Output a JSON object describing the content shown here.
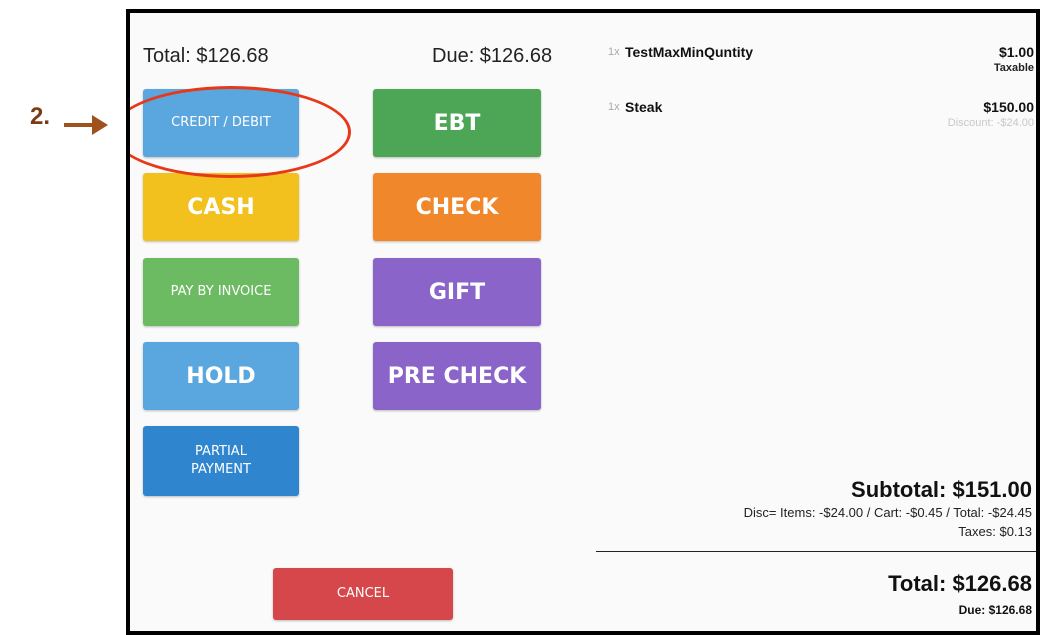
{
  "annotation": {
    "step": "2."
  },
  "header": {
    "total": "Total: $126.68",
    "due": "Due: $126.68"
  },
  "buttons": {
    "credit_debit": "CREDIT / DEBIT",
    "ebt": "EBT",
    "cash": "CASH",
    "check": "CHECK",
    "pay_by_invoice": "PAY BY INVOICE",
    "gift": "GIFT",
    "hold": "HOLD",
    "pre_check": "PRE CHECK",
    "partial_payment_line1": "PARTIAL",
    "partial_payment_line2": "PAYMENT",
    "cancel": "CANCEL"
  },
  "items": [
    {
      "qty": "1x",
      "name": "TestMaxMinQuntity",
      "price": "$1.00",
      "note": "Taxable"
    },
    {
      "qty": "1x",
      "name": "Steak",
      "price": "$150.00",
      "note": "Discount: -$24.00"
    }
  ],
  "summary": {
    "subtotal": "Subtotal: $151.00",
    "discounts": "Disc= Items: -$24.00 / Cart: -$0.45 / Total: -$24.45",
    "taxes": "Taxes: $0.13",
    "total": "Total: $126.68",
    "due": "Due: $126.68"
  },
  "colors": {
    "blue": "#5aa6de",
    "green": "#4ca656",
    "yellow": "#f2c11e",
    "orange": "#f0872a",
    "light_green": "#6cbb63",
    "purple": "#8a64c9",
    "dark_blue": "#2f86cf",
    "red": "#d6474c",
    "highlight": "#e8381a",
    "arrow": "#a0521c"
  }
}
